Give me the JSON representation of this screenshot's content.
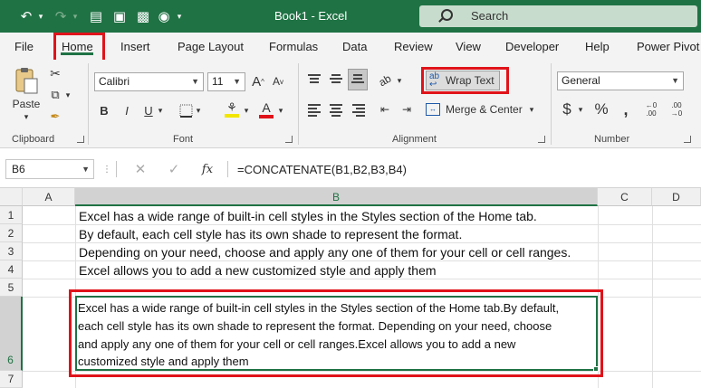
{
  "window": {
    "title": "Book1 - Excel",
    "search_placeholder": "Search"
  },
  "tabs": [
    "File",
    "Home",
    "Insert",
    "Page Layout",
    "Formulas",
    "Data",
    "Review",
    "View",
    "Developer",
    "Help",
    "Power Pivot"
  ],
  "ribbon": {
    "clipboard": {
      "paste_label": "Paste",
      "group_label": "Clipboard"
    },
    "font": {
      "font_name": "Calibri",
      "font_size": "11",
      "group_label": "Font",
      "bold": "B",
      "italic": "I",
      "underline": "U"
    },
    "alignment": {
      "wrap_text_label": "Wrap Text",
      "merge_label": "Merge & Center",
      "group_label": "Alignment"
    },
    "number": {
      "format": "General",
      "group_label": "Number",
      "currency": "$",
      "percent": "%"
    }
  },
  "formula_bar": {
    "name_box": "B6",
    "fx": "fx",
    "formula": "=CONCATENATE(B1,B2,B3,B4)"
  },
  "columns": [
    "A",
    "B",
    "C",
    "D"
  ],
  "rows": [
    "1",
    "2",
    "3",
    "4",
    "5",
    "6",
    "7"
  ],
  "cells": {
    "B1": "Excel has a wide range of built-in cell styles in the Styles section of the Home tab.",
    "B2": "By default, each cell style has its own shade to represent the format.",
    "B3": "Depending on your need, choose and apply any one of them for your cell or cell ranges.",
    "B4": "Excel allows you to add a new customized style and apply them",
    "B6_lines": [
      "Excel has a wide range of built-in cell styles in the Styles section of the Home tab.By default,",
      "each cell style has its own shade to represent the format. Depending on your need, choose",
      "and apply any one of them for your cell or cell ranges.Excel allows you to add a new",
      "customized style and apply them"
    ]
  },
  "colors": {
    "excel_green": "#1f7244",
    "highlight_red": "#e0131a"
  }
}
